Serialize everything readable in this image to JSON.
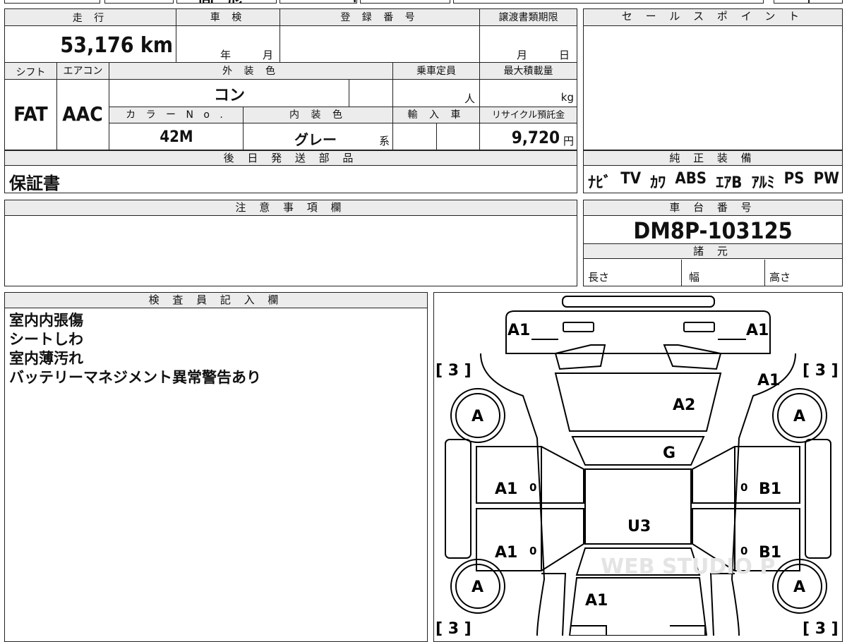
{
  "top_fragments": [
    "固",
    "形",
    "り",
    "り"
  ],
  "specs_box": {
    "headers": {
      "mileage": "走 行",
      "shaken": "車 検",
      "registration": "登 録 番 号",
      "transfer_deadline": "譲渡書類期限",
      "shift": "シフト",
      "aircon": "エアコン",
      "exterior_color": "外 装 色",
      "capacity": "乗車定員",
      "max_load": "最大積載量",
      "color_no": "カ ラ ー N o .",
      "interior_color": "内 装 色",
      "import": "輸 入 車",
      "recycle": "リサイクル預託金"
    },
    "values": {
      "mileage": "53,176 km",
      "shaken_year": "年",
      "shaken_month": "月",
      "transfer_month": "月",
      "transfer_day": "日",
      "shift": "FAT",
      "aircon": "AAC",
      "exterior_color": "コン",
      "capacity_unit": "人",
      "max_load_unit": "kg",
      "color_no": "42M",
      "interior_color": "グレー",
      "interior_suffix": "系",
      "recycle_amount": "9,720",
      "recycle_unit": "円"
    }
  },
  "later_parts": {
    "header": "後 日 発 送 部 品",
    "value": "保証書"
  },
  "sales_point": {
    "header": "セ ー ル ス ポ イ ン ト"
  },
  "standard_equipment": {
    "header": "純 正 装 備",
    "items": [
      "ﾅﾋﾞ",
      "TV",
      "ｶﾜ",
      "ABS",
      "ｴｱB",
      "ｱﾙﾐ",
      "PS",
      "PW"
    ]
  },
  "notes": {
    "header": "注 意 事 項 欄"
  },
  "chassis": {
    "header": "車 台 番 号",
    "number": "DM8P-103125",
    "specs_header": "諸 元",
    "length": "長さ",
    "width": "幅",
    "height": "高さ"
  },
  "inspector": {
    "header": "検 査 員 記 入 欄",
    "lines": [
      "室内内張傷",
      "シートしわ",
      "室内薄汚れ",
      "バッテリーマネジメント異常警告あり"
    ]
  },
  "diagram": {
    "front_left": "A1",
    "front_right": "A1",
    "bracket_tl": "[ 3 ]",
    "bracket_tr": "[ 3 ]",
    "bracket_bl": "[ 3 ]",
    "bracket_br": "[ 3 ]",
    "fender_right": "A1",
    "hood": "A2",
    "windshield": "G",
    "front_door_left": "A1",
    "front_door_right": "B1",
    "rear_door_left": "A1",
    "rear_door_right": "B1",
    "roof": "U3",
    "trunk": "A1",
    "tire_fl": "A",
    "tire_fr": "A",
    "tire_rl": "A",
    "tire_rr": "A",
    "zero": "0",
    "watermark": "WEB STUDIO P"
  }
}
